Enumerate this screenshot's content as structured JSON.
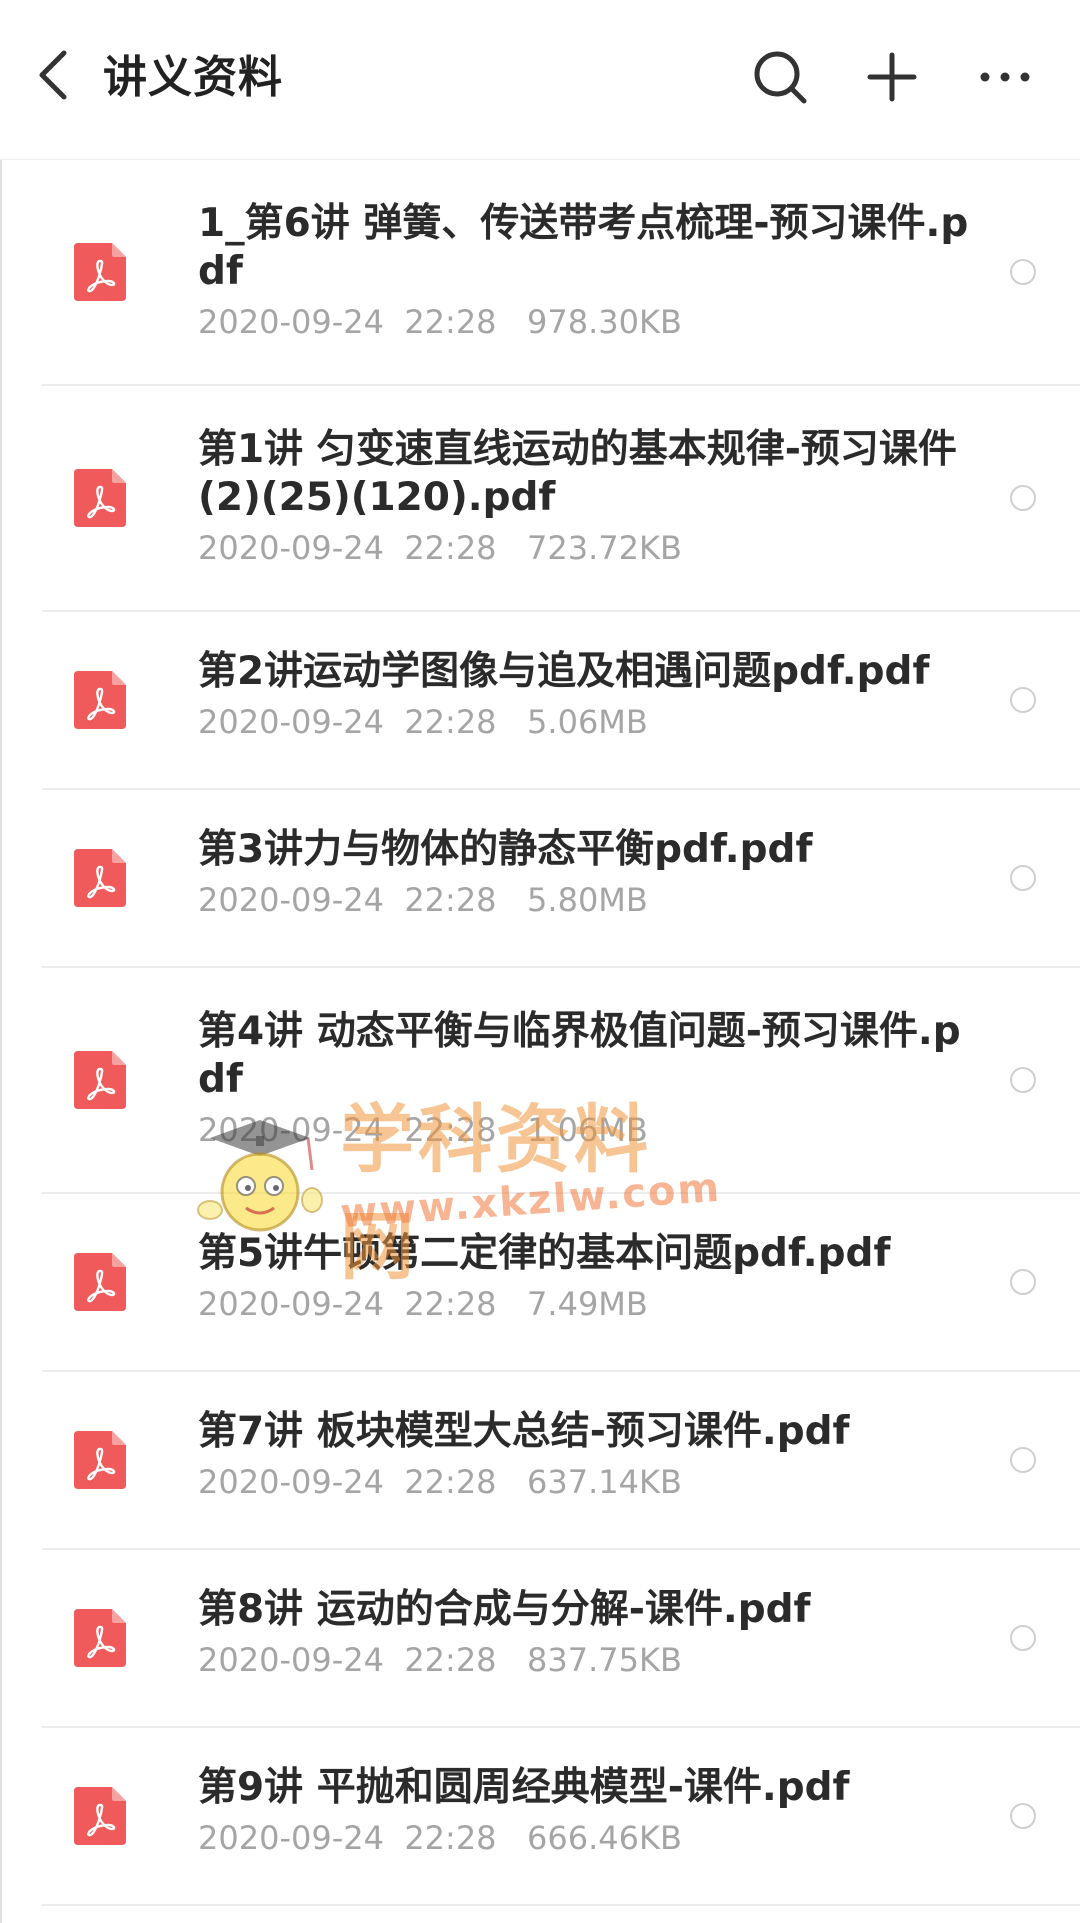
{
  "header": {
    "title": "讲义资料",
    "icons": [
      "back-icon",
      "search-icon",
      "add-icon",
      "more-icon"
    ]
  },
  "files": [
    {
      "name": "1_第6讲 弹簧、传送带考点梳理-预习课件.pdf",
      "date": "2020-09-24",
      "time": "22:28",
      "size": "978.30KB",
      "lines": 2
    },
    {
      "name": "第1讲 匀变速直线运动的基本规律-预习课件(2)(25)(120).pdf",
      "date": "2020-09-24",
      "time": "22:28",
      "size": "723.72KB",
      "lines": 2
    },
    {
      "name": "第2讲运动学图像与追及相遇问题pdf.pdf",
      "date": "2020-09-24",
      "time": "22:28",
      "size": "5.06MB",
      "lines": 1
    },
    {
      "name": "第3讲力与物体的静态平衡pdf.pdf",
      "date": "2020-09-24",
      "time": "22:28",
      "size": "5.80MB",
      "lines": 1
    },
    {
      "name": "第4讲 动态平衡与临界极值问题-预习课件.pdf",
      "date": "2020-09-24",
      "time": "22:28",
      "size": "1.06MB",
      "lines": 2
    },
    {
      "name": "第5讲牛顿第二定律的基本问题pdf.pdf",
      "date": "2020-09-24",
      "time": "22:28",
      "size": "7.49MB",
      "lines": 1
    },
    {
      "name": "第7讲 板块模型大总结-预习课件.pdf",
      "date": "2020-09-24",
      "time": "22:28",
      "size": "637.14KB",
      "lines": 1
    },
    {
      "name": "第8讲 运动的合成与分解-课件.pdf",
      "date": "2020-09-24",
      "time": "22:28",
      "size": "837.75KB",
      "lines": 1
    },
    {
      "name": "第9讲 平抛和圆周经典模型-课件.pdf",
      "date": "2020-09-24",
      "time": "22:28",
      "size": "666.46KB",
      "lines": 1
    }
  ],
  "watermark": {
    "title": "学科资料网",
    "url": "www.xkzlw.com"
  },
  "colors": {
    "pdf_icon": "#f05a5a",
    "meta_text": "#a5a5a5",
    "divider": "#ececec"
  }
}
